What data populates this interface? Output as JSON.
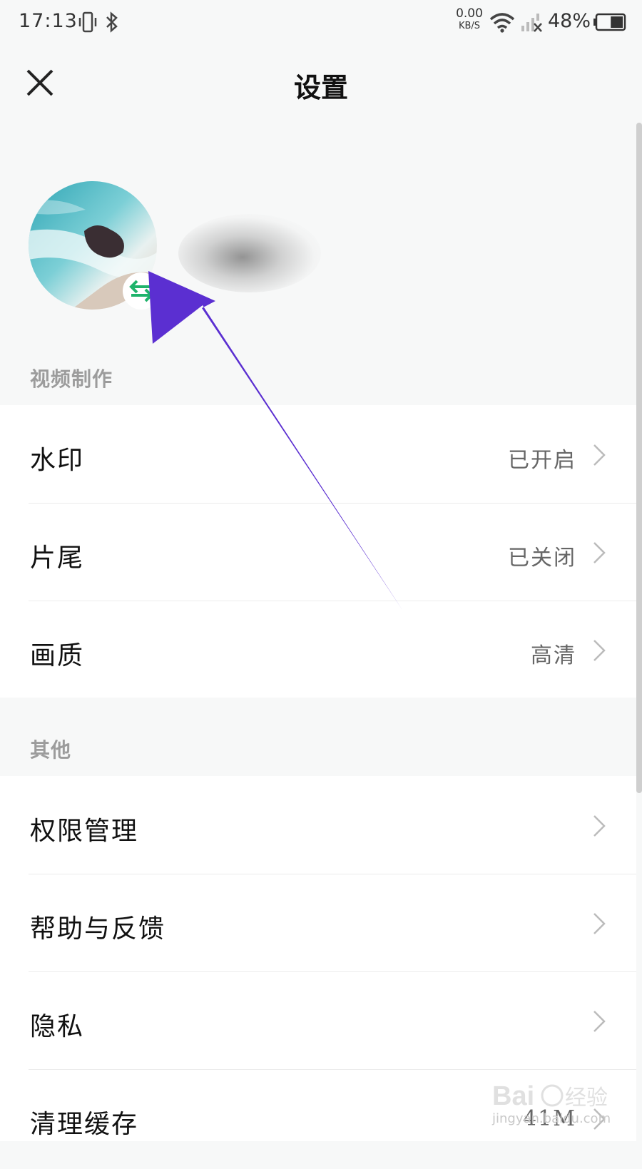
{
  "status_bar": {
    "time": "17:13",
    "net_speed_value": "0.00",
    "net_speed_unit": "KB/S",
    "battery_percent": "48%",
    "battery_level": 0.48
  },
  "header": {
    "title": "设置"
  },
  "sections": [
    {
      "title": "视频制作",
      "items": [
        {
          "label": "水印",
          "value": "已开启"
        },
        {
          "label": "片尾",
          "value": "已关闭"
        },
        {
          "label": "画质",
          "value": "高清"
        }
      ]
    },
    {
      "title": "其他",
      "items": [
        {
          "label": "权限管理",
          "value": ""
        },
        {
          "label": "帮助与反馈",
          "value": ""
        },
        {
          "label": "隐私",
          "value": ""
        },
        {
          "label": "清理缓存",
          "value": "41M"
        }
      ]
    }
  ],
  "watermark": {
    "logo_text": "Bai 经验",
    "url_text": "jingyan.baidu.com"
  },
  "colors": {
    "annotation_arrow": "#5b2fd1",
    "swap_badge": "#1fb36b"
  }
}
